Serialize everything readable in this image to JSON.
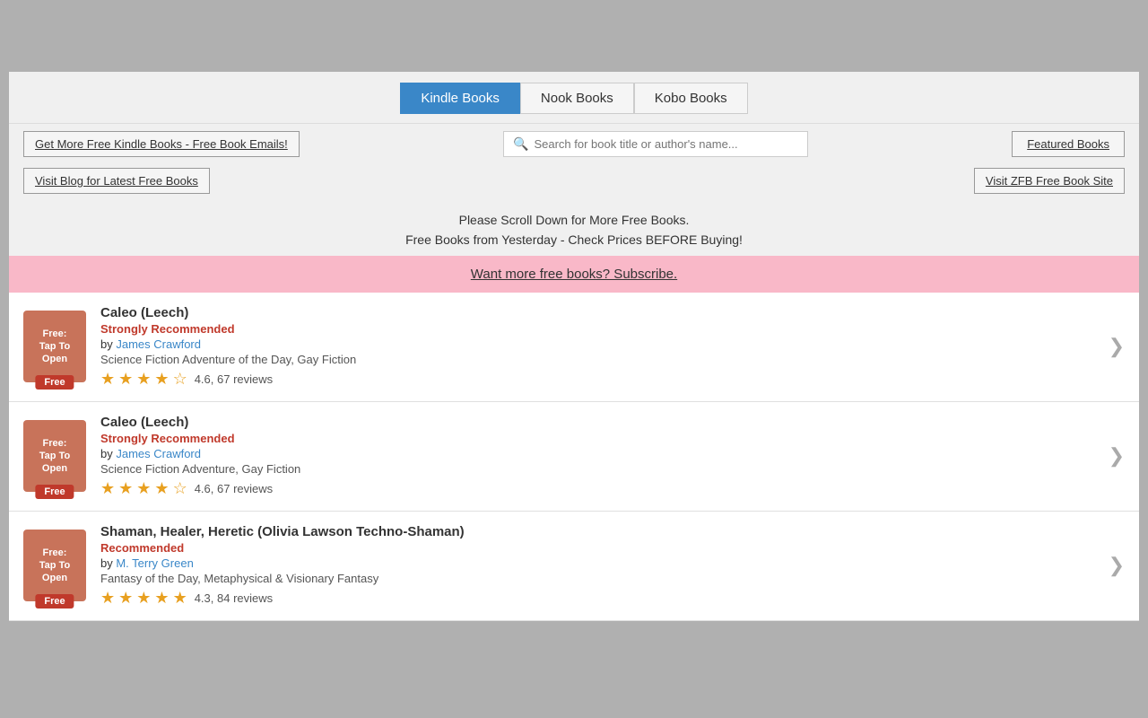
{
  "header": {
    "top_gray_height": 80
  },
  "tabs": {
    "items": [
      {
        "label": "Kindle Books",
        "active": true
      },
      {
        "label": "Nook Books",
        "active": false
      },
      {
        "label": "Kobo Books",
        "active": false
      }
    ]
  },
  "toolbar": {
    "free_kindle_label": "Get More Free Kindle Books - Free Book Emails!",
    "search_placeholder": "Search for book title or author's name...",
    "featured_label": "Featured Books",
    "blog_label": "Visit Blog for Latest Free Books",
    "zfb_label": "Visit ZFB Free Book Site"
  },
  "notice": {
    "line1": "Please Scroll Down for More Free Books.",
    "line2": "Free Books from Yesterday - Check Prices BEFORE Buying!"
  },
  "subscribe_banner": {
    "text": "Want more free books?  Subscribe."
  },
  "books": [
    {
      "thumb_text": "Free:\nTap To\nOpen",
      "free_badge": "Free",
      "title": "Caleo (Leech)",
      "recommendation": "Strongly Recommended",
      "recommendation_class": "strongly",
      "author": "James Crawford",
      "genre": "Science Fiction Adventure of the Day, Gay Fiction",
      "rating": "4.6",
      "reviews": "67 reviews",
      "stars": 4.6
    },
    {
      "thumb_text": "Free:\nTap To\nOpen",
      "free_badge": "Free",
      "title": "Caleo (Leech)",
      "recommendation": "Strongly Recommended",
      "recommendation_class": "strongly",
      "author": "James Crawford",
      "genre": "Science Fiction Adventure, Gay Fiction",
      "rating": "4.6",
      "reviews": "67 reviews",
      "stars": 4.6
    },
    {
      "thumb_text": "Free:\nTap To\nOpen",
      "free_badge": "Free",
      "title": "Shaman, Healer, Heretic (Olivia Lawson Techno-Shaman)",
      "recommendation": "Recommended",
      "recommendation_class": "recommended",
      "author": "M. Terry Green",
      "genre": "Fantasy of the Day, Metaphysical & Visionary Fantasy",
      "rating": "4.3",
      "reviews": "84 reviews",
      "stars": 4.3
    }
  ]
}
